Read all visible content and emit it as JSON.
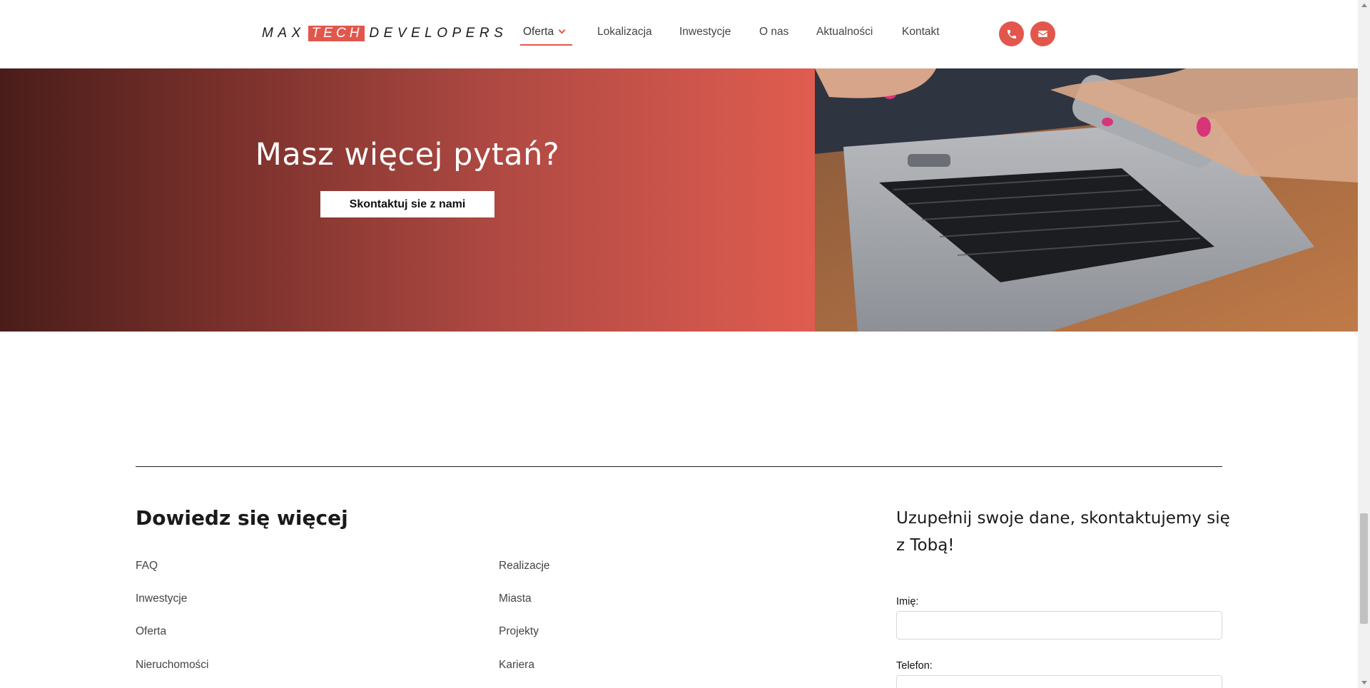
{
  "header": {
    "logo": {
      "before": "MAX",
      "highlight": "TECH",
      "after": "DEVELOPERS"
    },
    "nav": [
      {
        "label": "Oferta",
        "active": true,
        "has_dropdown": true
      },
      {
        "label": "Lokalizacja"
      },
      {
        "label": "Inwestycje"
      },
      {
        "label": "O nas"
      },
      {
        "label": "Aktualności"
      },
      {
        "label": "Kontakt"
      }
    ],
    "icons": [
      "phone-icon",
      "envelope-icon"
    ]
  },
  "hero": {
    "title": "Masz więcej pytań?",
    "button_label": "Skontaktuj sie z nami",
    "image": "laptop-and-smartphone-photo"
  },
  "footer": {
    "title": "Dowiedz się więcej",
    "links_col1": [
      "FAQ",
      "Inwestycje",
      "Oferta",
      "Nieruchomości"
    ],
    "links_col2": [
      "Realizacje",
      "Miasta",
      "Projekty",
      "Kariera"
    ]
  },
  "contact_form": {
    "title": "Uzupełnij swoje dane, skontaktujemy się z Tobą!",
    "fields": [
      {
        "label": "Imię:",
        "value": ""
      },
      {
        "label": "Telefon:",
        "value": ""
      }
    ]
  },
  "colors": {
    "accent": "#e2574c",
    "gradient_dark": "#4a1d1a",
    "gradient_light": "#e05c50"
  }
}
